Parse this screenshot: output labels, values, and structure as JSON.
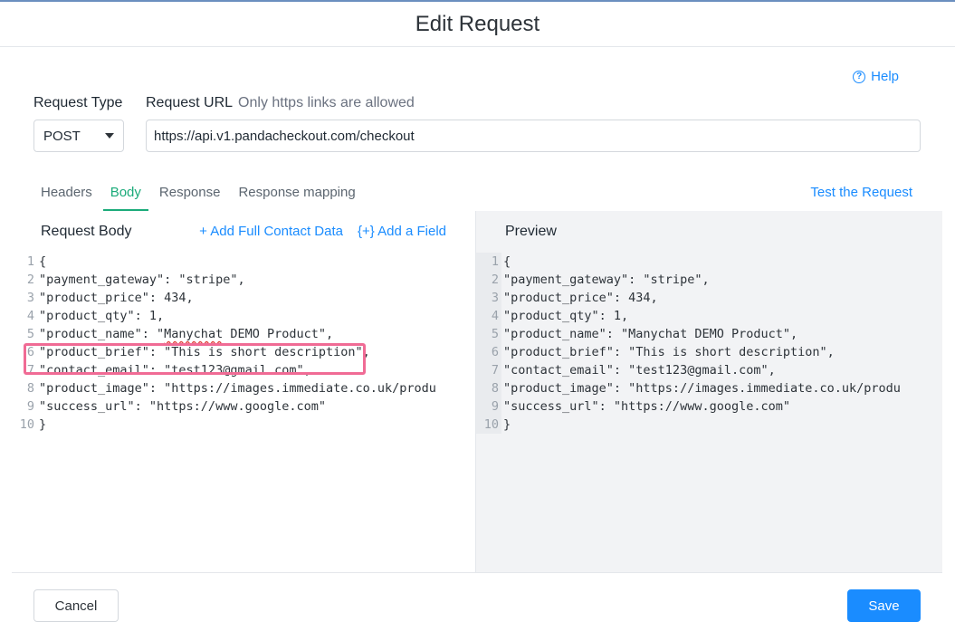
{
  "modal": {
    "title": "Edit Request"
  },
  "help": {
    "label": "Help"
  },
  "request_type": {
    "label": "Request Type",
    "value": "POST"
  },
  "request_url": {
    "label": "Request URL",
    "hint": "Only https links are allowed",
    "value": "https://api.v1.pandacheckout.com/checkout"
  },
  "tabs": [
    {
      "label": "Headers",
      "active": false
    },
    {
      "label": "Body",
      "active": true
    },
    {
      "label": "Response",
      "active": false
    },
    {
      "label": "Response mapping",
      "active": false
    }
  ],
  "test_request": {
    "label": "Test the Request"
  },
  "body_panel": {
    "title": "Request Body",
    "add_contact": "+ Add Full Contact Data",
    "add_field": "{+} Add a Field",
    "lines": [
      {
        "n": "1",
        "text": "{"
      },
      {
        "n": "2",
        "text": "\"payment_gateway\": \"stripe\","
      },
      {
        "n": "3",
        "text": "\"product_price\": 434,"
      },
      {
        "n": "4",
        "text": "\"product_qty\": 1,"
      },
      {
        "n": "5",
        "pre": "\"product_name\": \"",
        "spell": "Manychat",
        "post": " DEMO Product\","
      },
      {
        "n": "6",
        "text": "\"product_brief\": \"This is short description\","
      },
      {
        "n": "7",
        "text": "\"contact_email\": \"test123@gmail.com\","
      },
      {
        "n": "8",
        "text": "\"product_image\": \"https://images.immediate.co.uk/produ"
      },
      {
        "n": "9",
        "text": "\"success_url\": \"https://www.google.com\""
      },
      {
        "n": "10",
        "text": "}"
      }
    ]
  },
  "preview_panel": {
    "title": "Preview",
    "lines": [
      {
        "n": "1",
        "text": "{"
      },
      {
        "n": "2",
        "text": "\"payment_gateway\": \"stripe\","
      },
      {
        "n": "3",
        "text": "\"product_price\": 434,"
      },
      {
        "n": "4",
        "text": "\"product_qty\": 1,"
      },
      {
        "n": "5",
        "text": "\"product_name\": \"Manychat DEMO Product\","
      },
      {
        "n": "6",
        "text": "\"product_brief\": \"This is short description\","
      },
      {
        "n": "7",
        "text": "\"contact_email\": \"test123@gmail.com\","
      },
      {
        "n": "8",
        "text": "\"product_image\": \"https://images.immediate.co.uk/produ"
      },
      {
        "n": "9",
        "text": "\"success_url\": \"https://www.google.com\""
      },
      {
        "n": "10",
        "text": "}"
      }
    ]
  },
  "footer": {
    "cancel": "Cancel",
    "save": "Save"
  },
  "colors": {
    "accent": "#1a8cff",
    "tab_active": "#1bab7a",
    "highlight": "#f06b95"
  }
}
